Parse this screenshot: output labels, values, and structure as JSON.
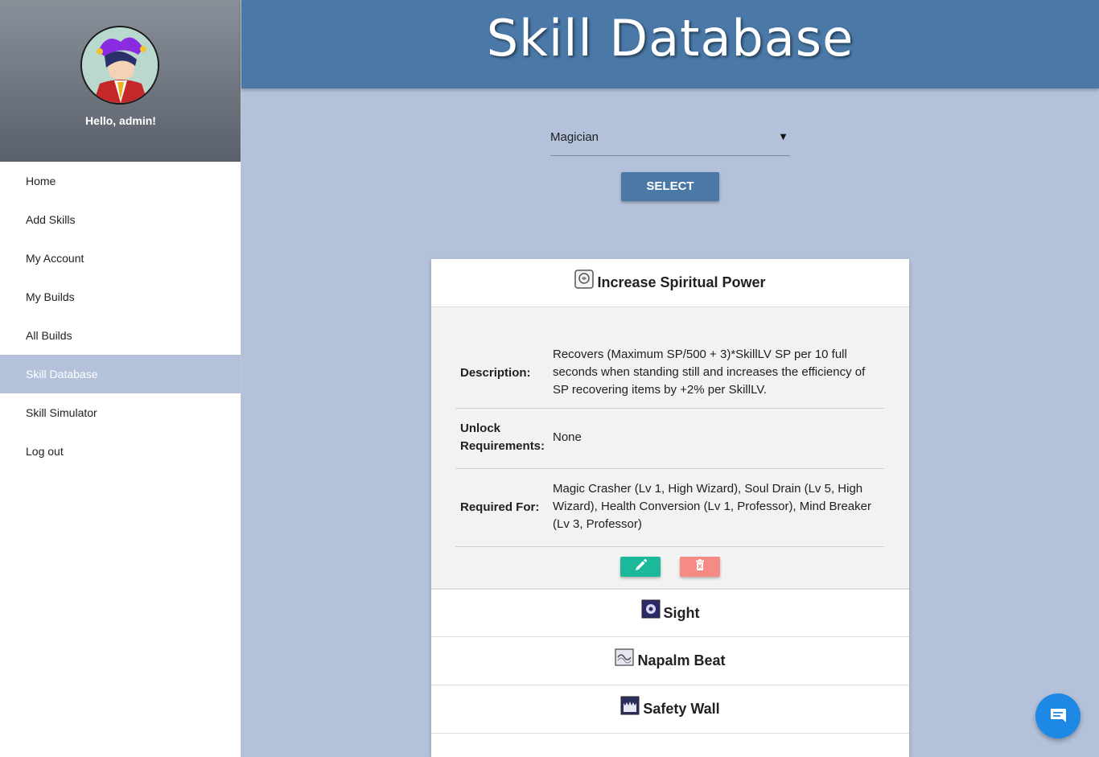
{
  "sidebar": {
    "greeting": "Hello, admin!",
    "items": [
      {
        "label": "Home"
      },
      {
        "label": "Add Skills"
      },
      {
        "label": "My Account"
      },
      {
        "label": "My Builds"
      },
      {
        "label": "All Builds"
      },
      {
        "label": "Skill Database",
        "active": true
      },
      {
        "label": "Skill Simulator"
      },
      {
        "label": "Log out"
      }
    ]
  },
  "header": {
    "title": "Skill Database"
  },
  "job_select": {
    "value": "Magician",
    "button_label": "SELECT"
  },
  "skills": [
    {
      "name": "Increase Spiritual Power",
      "icon": "spiritual-power-icon",
      "expanded": true,
      "labels": {
        "description": "Description:",
        "unlock_line1": "Unlock",
        "unlock_line2": "Requirements:",
        "required_for": "Required For:"
      },
      "description": "Recovers (Maximum SP/500 + 3)*SkillLV SP per 10 full seconds when standing still and increases the efficiency of SP recovering items by +2% per SkillLV.",
      "unlock_requirements": "None",
      "required_for": "Magic Crasher (Lv 1, High Wizard), Soul Drain (Lv 5, High Wizard), Health Conversion (Lv 1, Professor), Mind Breaker (Lv 3, Professor)"
    },
    {
      "name": "Sight",
      "icon": "sight-icon"
    },
    {
      "name": "Napalm Beat",
      "icon": "napalm-beat-icon"
    },
    {
      "name": "Safety Wall",
      "icon": "safety-wall-icon"
    }
  ],
  "colors": {
    "header": "#4a79a8",
    "background": "#b3c1da",
    "edit": "#1bb99a",
    "delete": "#f68a84",
    "fab": "#1e88e5"
  }
}
